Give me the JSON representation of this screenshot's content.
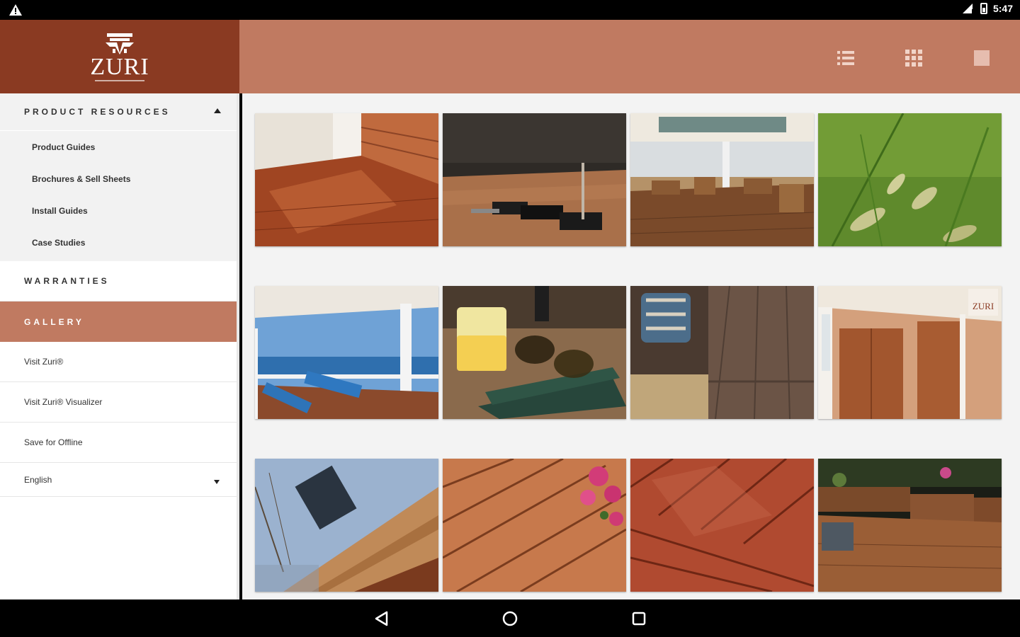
{
  "status_bar": {
    "time": "5:47",
    "warning_icon": "warning-icon",
    "signal_icon": "signal-icon",
    "battery_icon": "battery-icon"
  },
  "header": {
    "logo_text": "ZURI",
    "brand_color": "#8a3a22",
    "toolbar_color": "#c07a61",
    "view_buttons": [
      "list-view-icon",
      "grid-view-icon",
      "single-view-icon"
    ]
  },
  "sidebar": {
    "product_resources": {
      "label": "PRODUCT RESOURCES",
      "expanded": true,
      "items": [
        "Product Guides",
        "Brochures & Sell Sheets",
        "Install Guides",
        "Case Studies"
      ]
    },
    "warranties": "WARRANTIES",
    "gallery": "GALLERY",
    "links": [
      "Visit Zuri®",
      "Visit Zuri® Visualizer",
      "Save for Offline"
    ],
    "language": "English"
  },
  "gallery": {
    "tiles": [
      "interior-wood-floor-with-sliding-door",
      "deck-fastener-tools-on-wood",
      "restaurant-dining-room-wood-deck",
      "green-grass-closeup",
      "porch-deck-with-ocean-view",
      "lemonade-sunglasses-book-on-deck",
      "wicker-seat-with-pillow-on-deck",
      "shingle-house-with-wood-door",
      "wood-siding-low-angle-with-trees",
      "wood-deck-boards-with-flowers",
      "wet-red-deck-boards",
      "backyard-deck-with-planters-and-steps"
    ]
  },
  "navbar": {
    "back_icon": "back-icon",
    "home_icon": "home-icon",
    "recents_icon": "recents-icon"
  }
}
